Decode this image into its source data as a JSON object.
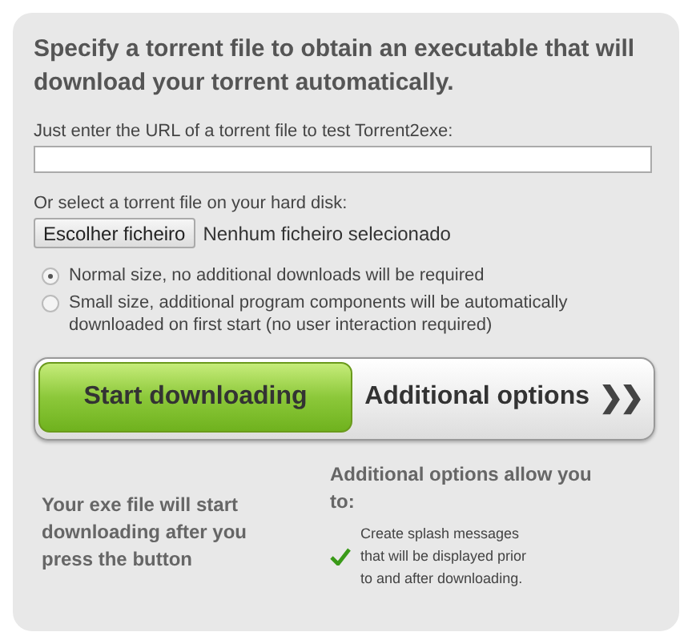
{
  "heading": "Specify a torrent file to obtain an executable that will download your torrent automatically.",
  "url_field": {
    "label": "Just enter the URL of a torrent file to test Torrent2exe:"
  },
  "file_picker": {
    "label": "Or select a torrent file on your hard disk:",
    "button": "Escolher ficheiro",
    "status": "Nenhum ficheiro selecionado"
  },
  "size_options": [
    {
      "label": "Normal size, no additional downloads will be required",
      "selected": true
    },
    {
      "label": "Small size, additional program components will be automatically downloaded on first start (no user interaction required)",
      "selected": false
    }
  ],
  "start_button": "Start downloading",
  "options_button": {
    "label": "Additional options",
    "arrow": "❯❯"
  },
  "left_note": "Your exe file will start downloading after you press the button",
  "right_note": {
    "heading": "Additional options allow you to:",
    "items": [
      "Create splash messages that will be displayed prior to and after downloading."
    ]
  }
}
